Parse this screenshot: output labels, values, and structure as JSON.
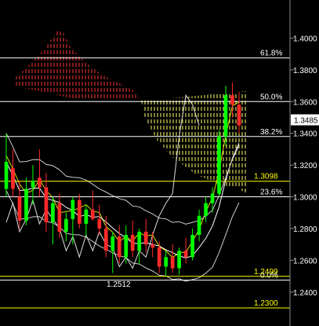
{
  "chart_data": {
    "type": "candlestick",
    "title": "",
    "xlabel": "",
    "ylabel": "",
    "ylim": [
      1.2186,
      1.424
    ],
    "y_ticks": [
      "1.4000",
      "1.3800",
      "1.3600",
      "1.3400",
      "1.3200",
      "1.3000",
      "1.2800",
      "1.2600",
      "1.2400"
    ],
    "current_price": "1.3485",
    "fib_levels": [
      {
        "label": "61.8%",
        "value": 1.3875,
        "color": "#ffffff"
      },
      {
        "label": "50.0%",
        "value": 1.36,
        "color": "#ffffff"
      },
      {
        "label": "38.2%",
        "value": 1.338,
        "color": "#ffffff"
      },
      {
        "label": "23.6%",
        "value": 1.3,
        "color": "#ffffff"
      },
      {
        "label": "0.0%",
        "value": 1.2475,
        "color": "#ffffff"
      }
    ],
    "support_levels": [
      {
        "label": "1.3098",
        "value": 1.3098,
        "color": "#ffff00"
      },
      {
        "label": "1.2499",
        "value": 1.2499,
        "color": "#ffff00"
      },
      {
        "label": "1.2300",
        "value": 1.23,
        "color": "#ffff00"
      }
    ],
    "low_annotation": "1.2512",
    "colors": {
      "up": "#00ff00",
      "down": "#ff2a2a",
      "cloud_red": "#ff3333",
      "cloud_yellow": "#ffff66",
      "line_yellow": "#dddd00"
    },
    "candles": [
      {
        "o": 1.305,
        "h": 1.34,
        "l": 1.3,
        "c": 1.322
      },
      {
        "o": 1.318,
        "h": 1.33,
        "l": 1.3,
        "c": 1.305
      },
      {
        "o": 1.3,
        "h": 1.31,
        "l": 1.28,
        "c": 1.285
      },
      {
        "o": 1.285,
        "h": 1.312,
        "l": 1.282,
        "c": 1.305
      },
      {
        "o": 1.306,
        "h": 1.32,
        "l": 1.295,
        "c": 1.31
      },
      {
        "o": 1.312,
        "h": 1.33,
        "l": 1.3,
        "c": 1.306
      },
      {
        "o": 1.306,
        "h": 1.315,
        "l": 1.278,
        "c": 1.284
      },
      {
        "o": 1.284,
        "h": 1.3,
        "l": 1.27,
        "c": 1.296
      },
      {
        "o": 1.296,
        "h": 1.302,
        "l": 1.274,
        "c": 1.278
      },
      {
        "o": 1.278,
        "h": 1.29,
        "l": 1.272,
        "c": 1.286
      },
      {
        "o": 1.286,
        "h": 1.3,
        "l": 1.27,
        "c": 1.298
      },
      {
        "o": 1.298,
        "h": 1.302,
        "l": 1.28,
        "c": 1.283
      },
      {
        "o": 1.283,
        "h": 1.295,
        "l": 1.275,
        "c": 1.292
      },
      {
        "o": 1.292,
        "h": 1.304,
        "l": 1.285,
        "c": 1.286
      },
      {
        "o": 1.286,
        "h": 1.295,
        "l": 1.276,
        "c": 1.28
      },
      {
        "o": 1.28,
        "h": 1.288,
        "l": 1.262,
        "c": 1.266
      },
      {
        "o": 1.266,
        "h": 1.278,
        "l": 1.252,
        "c": 1.275
      },
      {
        "o": 1.275,
        "h": 1.282,
        "l": 1.258,
        "c": 1.262
      },
      {
        "o": 1.262,
        "h": 1.282,
        "l": 1.258,
        "c": 1.276
      },
      {
        "o": 1.276,
        "h": 1.285,
        "l": 1.262,
        "c": 1.266
      },
      {
        "o": 1.266,
        "h": 1.28,
        "l": 1.258,
        "c": 1.278
      },
      {
        "o": 1.278,
        "h": 1.286,
        "l": 1.265,
        "c": 1.27
      },
      {
        "o": 1.27,
        "h": 1.278,
        "l": 1.262,
        "c": 1.268
      },
      {
        "o": 1.268,
        "h": 1.272,
        "l": 1.252,
        "c": 1.256
      },
      {
        "o": 1.256,
        "h": 1.266,
        "l": 1.25,
        "c": 1.262
      },
      {
        "o": 1.262,
        "h": 1.27,
        "l": 1.252,
        "c": 1.255
      },
      {
        "o": 1.255,
        "h": 1.268,
        "l": 1.251,
        "c": 1.266
      },
      {
        "o": 1.266,
        "h": 1.274,
        "l": 1.258,
        "c": 1.262
      },
      {
        "o": 1.262,
        "h": 1.28,
        "l": 1.26,
        "c": 1.276
      },
      {
        "o": 1.276,
        "h": 1.292,
        "l": 1.272,
        "c": 1.288
      },
      {
        "o": 1.288,
        "h": 1.3,
        "l": 1.284,
        "c": 1.296
      },
      {
        "o": 1.296,
        "h": 1.306,
        "l": 1.29,
        "c": 1.302
      },
      {
        "o": 1.302,
        "h": 1.342,
        "l": 1.3,
        "c": 1.338
      },
      {
        "o": 1.338,
        "h": 1.37,
        "l": 1.332,
        "c": 1.364
      },
      {
        "o": 1.364,
        "h": 1.372,
        "l": 1.35,
        "c": 1.358
      },
      {
        "o": 1.358,
        "h": 1.366,
        "l": 1.34,
        "c": 1.345
      }
    ]
  }
}
